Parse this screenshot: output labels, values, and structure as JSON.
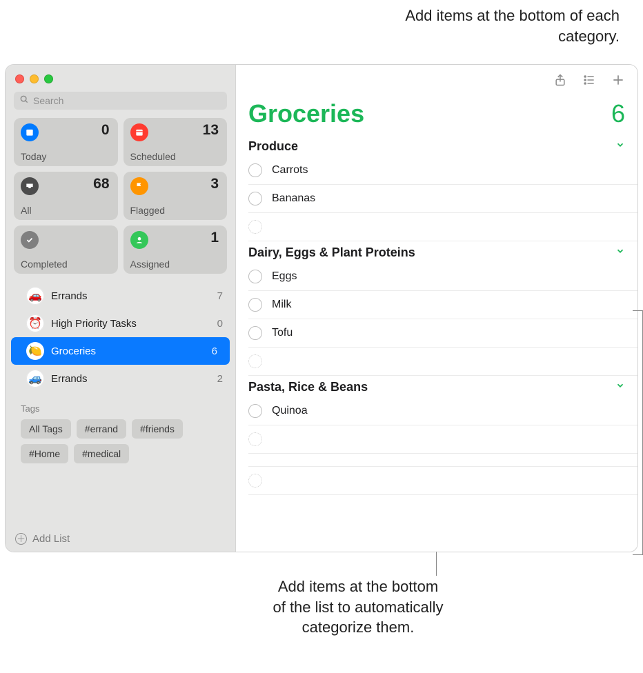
{
  "annotations": {
    "top": "Add items at the bottom of each category.",
    "bottom": "Add items at the bottom of the list to automatically categorize them."
  },
  "search": {
    "placeholder": "Search"
  },
  "smart": {
    "today": {
      "label": "Today",
      "count": "0"
    },
    "scheduled": {
      "label": "Scheduled",
      "count": "13"
    },
    "all": {
      "label": "All",
      "count": "68"
    },
    "flagged": {
      "label": "Flagged",
      "count": "3"
    },
    "completed": {
      "label": "Completed",
      "count": ""
    },
    "assigned": {
      "label": "Assigned",
      "count": "1"
    }
  },
  "lists": [
    {
      "emoji": "🚗",
      "name": "Errands",
      "count": "7",
      "selected": false
    },
    {
      "emoji": "⏰",
      "name": "High Priority Tasks",
      "count": "0",
      "selected": false
    },
    {
      "emoji": "🍋",
      "name": "Groceries",
      "count": "6",
      "selected": true
    },
    {
      "emoji": "🚙",
      "name": "Errands",
      "count": "2",
      "selected": false
    }
  ],
  "tags": {
    "title": "Tags",
    "items": [
      "All Tags",
      "#errand",
      "#friends",
      "#Home",
      "#medical"
    ]
  },
  "addList": "Add List",
  "main": {
    "title": "Groceries",
    "count": "6",
    "sections": [
      {
        "name": "Produce",
        "items": [
          "Carrots",
          "Bananas"
        ]
      },
      {
        "name": "Dairy, Eggs & Plant Proteins",
        "items": [
          "Eggs",
          "Milk",
          "Tofu"
        ]
      },
      {
        "name": "Pasta, Rice & Beans",
        "items": [
          "Quinoa"
        ]
      }
    ]
  }
}
